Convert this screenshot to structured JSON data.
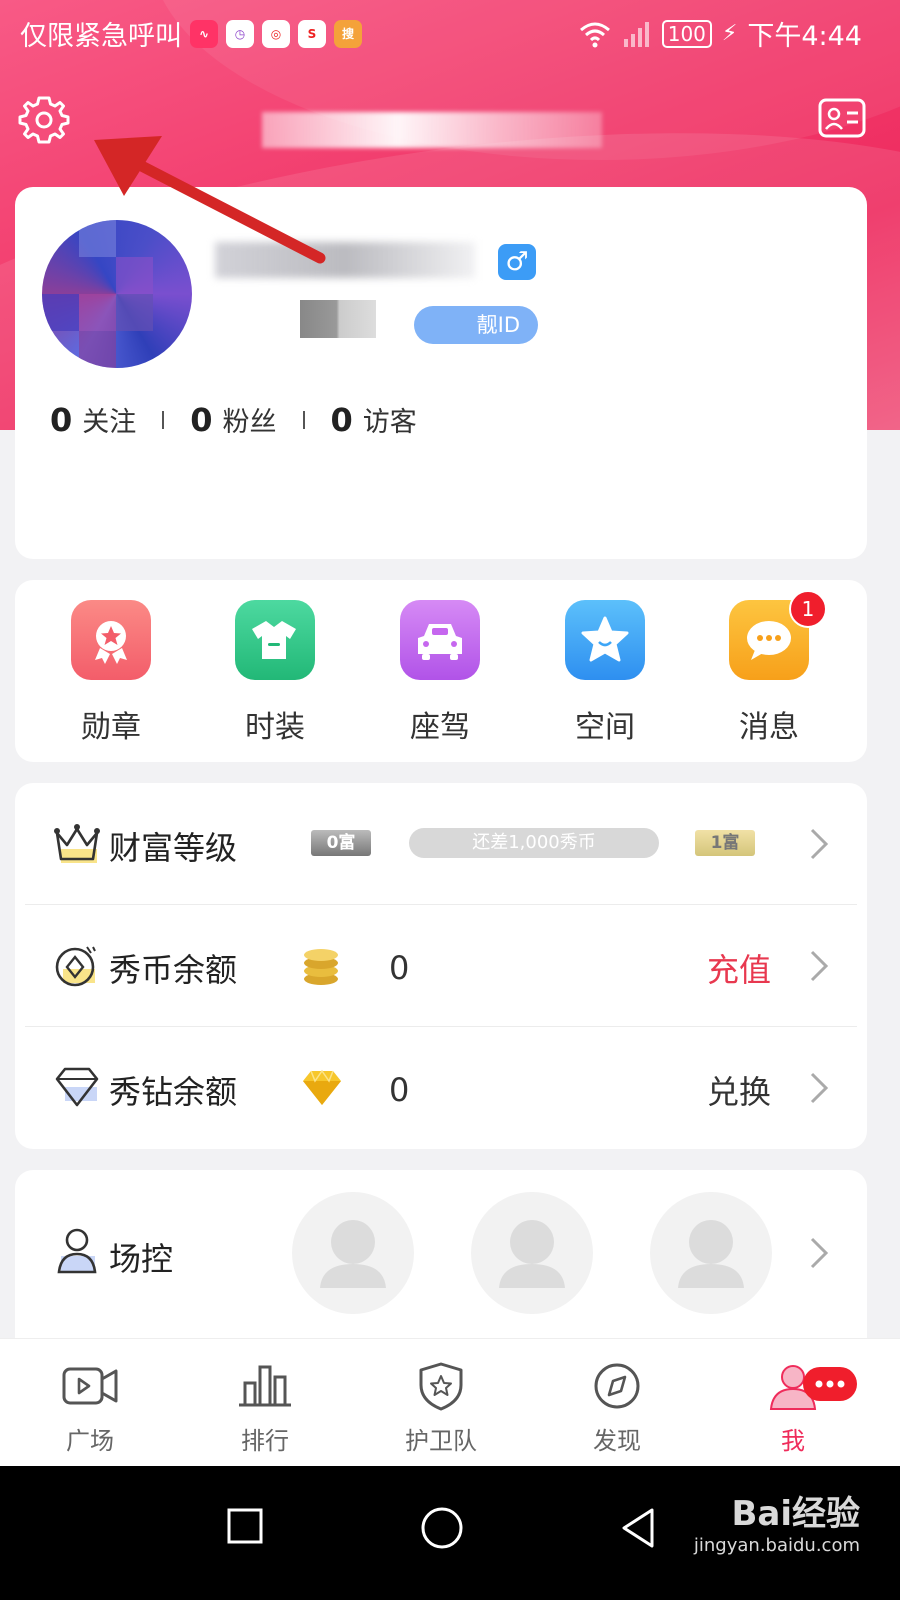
{
  "status_bar": {
    "carrier_text": "仅限紧急呼叫",
    "battery": "100",
    "time": "下午4:44",
    "app_icons": [
      "pulse-app-icon",
      "clock-app-icon",
      "phoenix-app-icon",
      "sina-app-icon",
      "sohu-app-icon"
    ]
  },
  "header": {
    "settings_icon": "gear-icon",
    "profile_card_icon": "id-card-icon"
  },
  "profile": {
    "gender_symbol": "♂",
    "id_label": "靓ID",
    "stats": [
      {
        "count": "0",
        "label": "关注"
      },
      {
        "count": "0",
        "label": "粉丝"
      },
      {
        "count": "0",
        "label": "访客"
      }
    ]
  },
  "quick_actions": [
    {
      "label": "勋章",
      "icon": "medal-icon",
      "color": "#f76a72"
    },
    {
      "label": "时装",
      "icon": "shirt-icon",
      "color": "#34c98a"
    },
    {
      "label": "座驾",
      "icon": "car-icon",
      "color": "#c667ef"
    },
    {
      "label": "空间",
      "icon": "star-icon",
      "color": "#3ea6f7"
    },
    {
      "label": "消息",
      "icon": "chat-icon",
      "color": "#fbb127",
      "badge": "1"
    }
  ],
  "wallet": {
    "wealth": {
      "label": "财富等级",
      "current_level": "0富",
      "next_level": "1富",
      "progress_text": "还差1,000秀币",
      "progress": 0
    },
    "coins": {
      "label": "秀币余额",
      "amount": "0",
      "action": "充值",
      "action_color": "#e8384f"
    },
    "diamonds": {
      "label": "秀钻余额",
      "amount": "0",
      "action": "兑换",
      "action_color": "#333333"
    }
  },
  "room_control": {
    "label": "场控"
  },
  "tabbar": [
    {
      "label": "广场",
      "icon": "video-icon"
    },
    {
      "label": "排行",
      "icon": "bar-chart-icon"
    },
    {
      "label": "护卫队",
      "icon": "shield-icon"
    },
    {
      "label": "发现",
      "icon": "compass-icon"
    },
    {
      "label": "我",
      "icon": "profile-icon",
      "active": true
    }
  ],
  "watermark": {
    "brand": "Bai经验",
    "url": "jingyan.baidu.com"
  },
  "colors": {
    "primary": "#ef2c5b",
    "header_gradient_start": "#f85a86",
    "header_gradient_end": "#ee2a5e"
  }
}
